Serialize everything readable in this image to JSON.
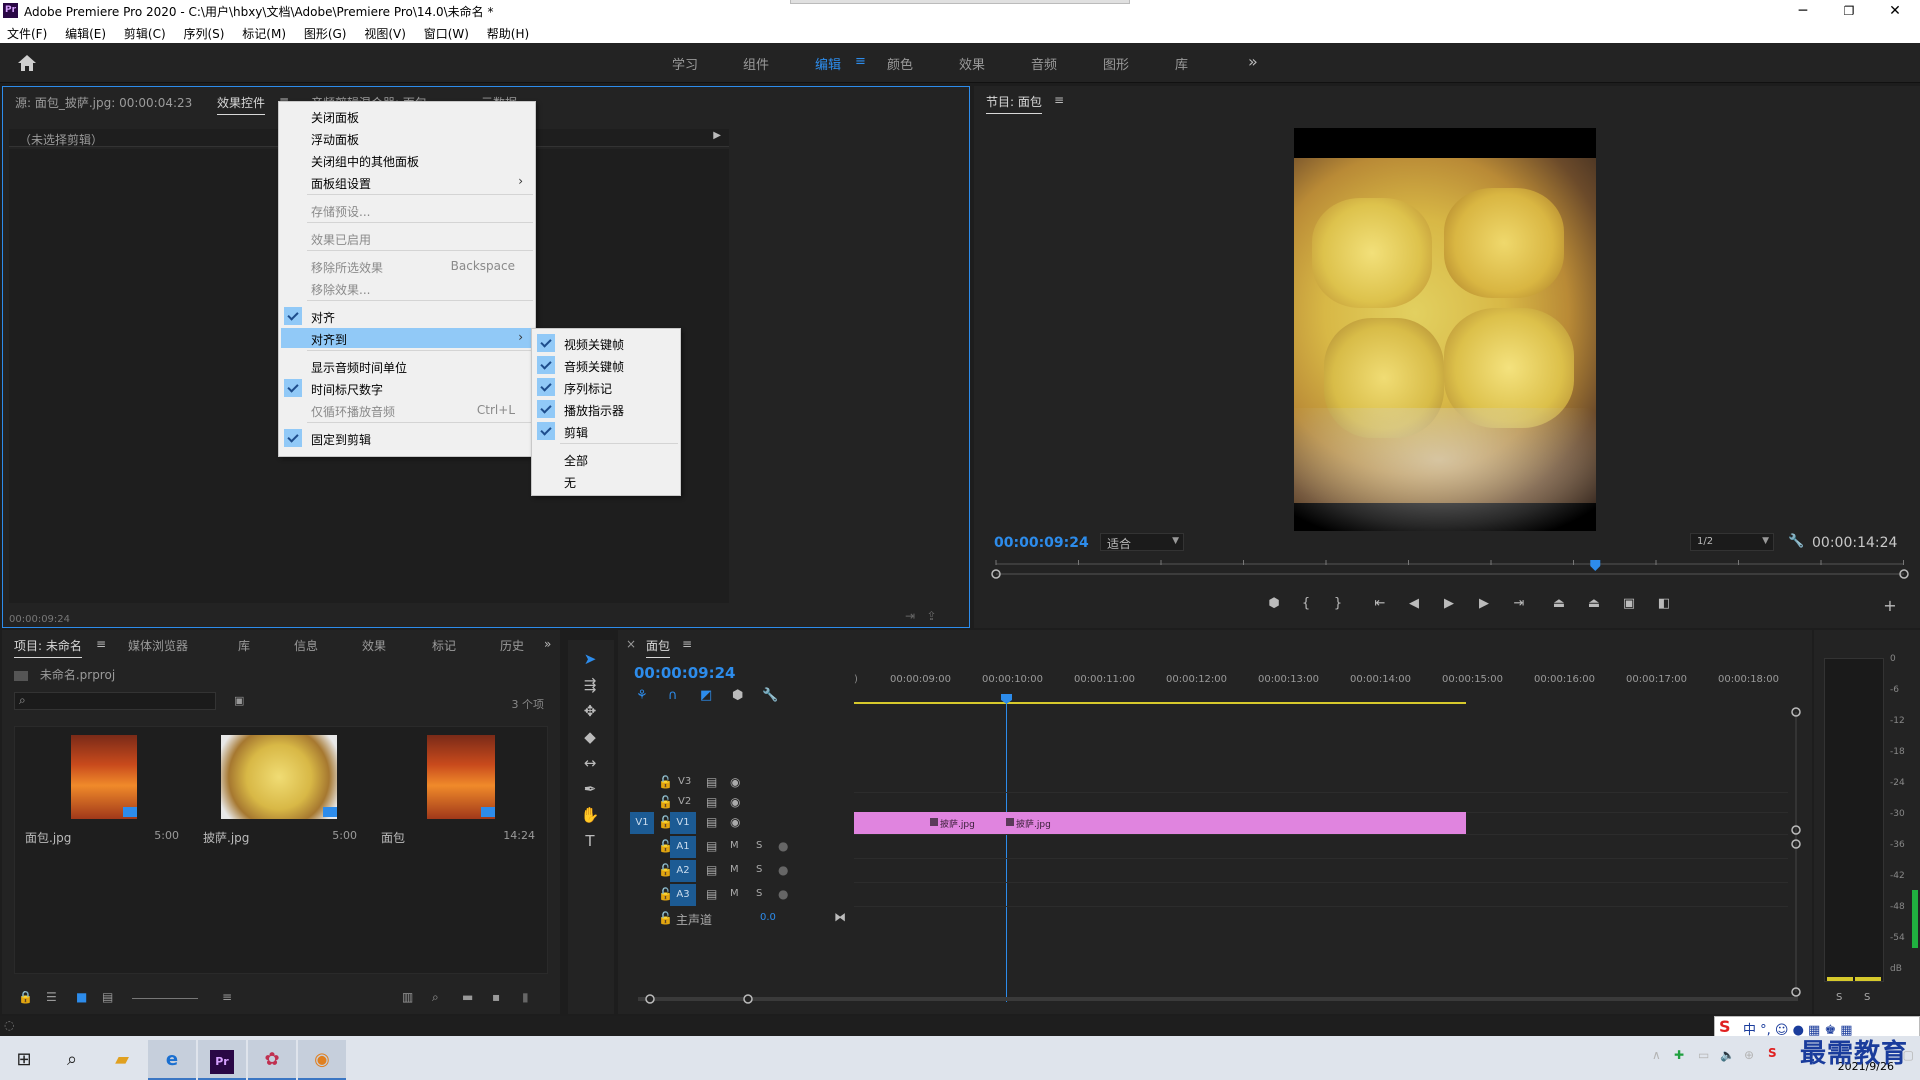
{
  "titlebar": {
    "app_icon": "Pr",
    "title": "Adobe Premiere Pro 2020 - C:\\用户\\hbxy\\文档\\Adobe\\Premiere Pro\\14.0\\未命名 *",
    "minimize": "─",
    "maximize": "❐",
    "close": "✕"
  },
  "menubar": [
    "文件(F)",
    "编辑(E)",
    "剪辑(C)",
    "序列(S)",
    "标记(M)",
    "图形(G)",
    "视图(V)",
    "窗口(W)",
    "帮助(H)"
  ],
  "workspaces": {
    "tabs": [
      "学习",
      "组件",
      "编辑",
      "颜色",
      "效果",
      "音频",
      "图形",
      "库"
    ],
    "active": "编辑",
    "more_icon": "»"
  },
  "source_panel": {
    "tabs": [
      "源: 面包_披萨.jpg: 00:00:04:23",
      "效果控件",
      "音频剪辑混合器: 面包",
      "元数据"
    ],
    "active_tab": "效果控件",
    "no_clip": "（未选择剪辑）",
    "timecode": "00:00:09:24"
  },
  "context_menu": {
    "items": [
      {
        "label": "关闭面板",
        "checked": false,
        "disabled": false
      },
      {
        "label": "浮动面板",
        "checked": false,
        "disabled": false
      },
      {
        "label": "关闭组中的其他面板",
        "checked": false,
        "disabled": false
      },
      {
        "label": "面板组设置",
        "checked": false,
        "disabled": false,
        "submenu": true
      },
      {
        "label": "存储预设...",
        "checked": false,
        "disabled": true
      },
      {
        "label": "效果已启用",
        "checked": false,
        "disabled": true
      },
      {
        "label": "移除所选效果",
        "shortcut": "Backspace",
        "checked": false,
        "disabled": true
      },
      {
        "label": "移除效果...",
        "checked": false,
        "disabled": true
      },
      {
        "label": "对齐",
        "checked": true,
        "disabled": false
      },
      {
        "label": "对齐到",
        "checked": false,
        "disabled": false,
        "submenu": true,
        "highlighted": true
      },
      {
        "label": "显示音频时间单位",
        "checked": false,
        "disabled": false
      },
      {
        "label": "时间标尺数字",
        "checked": true,
        "disabled": false
      },
      {
        "label": "仅循环播放音频",
        "shortcut": "Ctrl+L",
        "checked": false,
        "disabled": true
      },
      {
        "label": "固定到剪辑",
        "checked": true,
        "disabled": false
      }
    ]
  },
  "submenu": {
    "items": [
      {
        "label": "视频关键帧",
        "checked": true
      },
      {
        "label": "音频关键帧",
        "checked": true
      },
      {
        "label": "序列标记",
        "checked": true
      },
      {
        "label": "播放指示器",
        "checked": true
      },
      {
        "label": "剪辑",
        "checked": true
      },
      {
        "label": "全部",
        "checked": false
      },
      {
        "label": "无",
        "checked": false
      }
    ]
  },
  "program_panel": {
    "title": "节目: 面包",
    "timecode": "00:00:09:24",
    "fit": "适合",
    "resolution": "1/2",
    "duration": "00:00:14:24",
    "playhead_fraction": 0.66
  },
  "project_panel": {
    "tabs": [
      "项目: 未命名",
      "媒体浏览器",
      "库",
      "信息",
      "效果",
      "标记",
      "历史"
    ],
    "active_tab": "项目: 未命名",
    "project_file": "未命名.prproj",
    "item_count": "3 个项",
    "items": [
      {
        "name": "面包.jpg",
        "duration": "5:00"
      },
      {
        "name": "披萨.jpg",
        "duration": "5:00"
      },
      {
        "name": "面包",
        "duration": "14:24"
      }
    ]
  },
  "timeline_panel": {
    "title": "面包",
    "timecode": "00:00:09:24",
    "ruler_ticks": [
      "00:00:09:00",
      "00:00:10:00",
      "00:00:11:00",
      "00:00:12:00",
      "00:00:13:00",
      "00:00:14:00",
      "00:00:15:00",
      "00:00:16:00",
      "00:00:17:00",
      "00:00:18:00"
    ],
    "video_tracks": [
      "V3",
      "V2",
      "V1"
    ],
    "audio_tracks": [
      "A1",
      "A2",
      "A3"
    ],
    "source_patch": "V1",
    "mute_label": "M",
    "solo_label": "S",
    "master_label": "主声道",
    "master_value": "0.0",
    "clips": [
      {
        "label": "披萨.jpg"
      },
      {
        "label": "披萨.jpg"
      }
    ]
  },
  "meters": {
    "scale": [
      "0",
      "-6",
      "-12",
      "-18",
      "-24",
      "-30",
      "-36",
      "-42",
      "-48",
      "-54",
      "dB"
    ],
    "solo": [
      "S",
      "S"
    ]
  },
  "taskbar": {
    "date": "2021/9/26"
  },
  "watermark": "最需教育",
  "colors": {
    "accent": "#2d8ceb",
    "clip": "#e084df",
    "menu_highlight": "#91c9f7"
  }
}
